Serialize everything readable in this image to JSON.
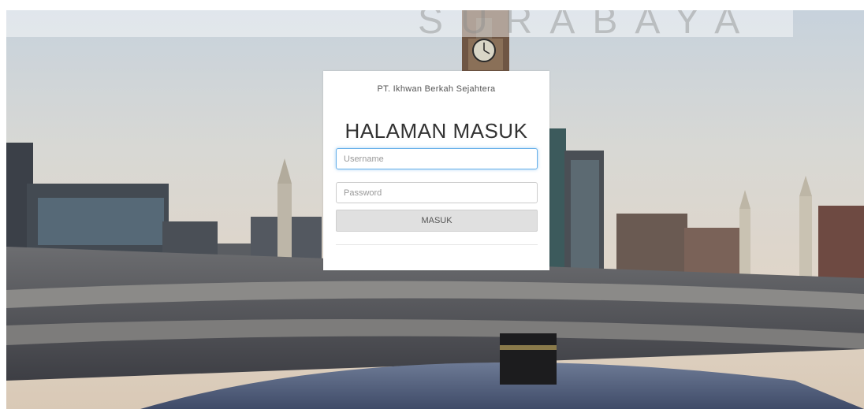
{
  "watermark": "SURABAYA",
  "login": {
    "company_name": "PT. Ikhwan Berkah Sejahtera",
    "title": "HALAMAN MASUK",
    "username_placeholder": "Username",
    "password_placeholder": "Password",
    "submit_label": "MASUK"
  },
  "colors": {
    "focus_border": "#66afe9",
    "button_bg": "#e0e0e0"
  }
}
